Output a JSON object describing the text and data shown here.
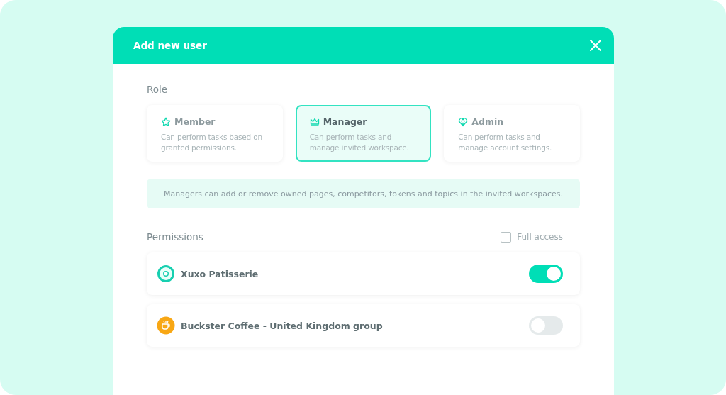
{
  "dialog": {
    "title": "Add new user"
  },
  "role": {
    "label": "Role",
    "options": [
      {
        "name": "Member",
        "description": "Can perform tasks based on granted permissions.",
        "selected": false
      },
      {
        "name": "Manager",
        "description": "Can perform tasks and manage invited workspace.",
        "selected": true
      },
      {
        "name": "Admin",
        "description": "Can perform tasks and manage account settings.",
        "selected": false
      }
    ],
    "info": "Managers can add or remove owned pages, competitors, tokens and topics in the invited workspaces."
  },
  "permissions": {
    "label": "Permissions",
    "full_access": {
      "label": "Full access",
      "checked": false
    },
    "items": [
      {
        "name": "Xuxo Patisserie",
        "on": true
      },
      {
        "name": "Buckster Coffee - United Kingdom group",
        "on": false
      }
    ]
  }
}
